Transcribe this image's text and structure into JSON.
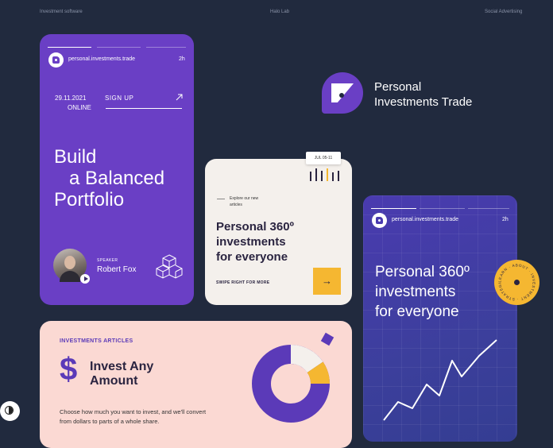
{
  "top_labels": {
    "left": "Investment software",
    "center": "Halo Lab",
    "right": "Social Advertising"
  },
  "story1": {
    "site": "personal.investments.trade",
    "time": "2h",
    "date": "29.11.2021",
    "mode": "ONLINE",
    "cta": "SIGN UP",
    "headline": [
      "Build",
      "a Balanced",
      "Portfolio"
    ],
    "speaker_role": "SPEAKER",
    "speaker_name": "Robert Fox"
  },
  "brand": {
    "line1": "Personal",
    "line2": "Investments Trade",
    "color": "#6a3fc5"
  },
  "post": {
    "date_tag": "JUL 05-11",
    "explore": [
      "Explore our new",
      "articles"
    ],
    "headline": [
      "Personal 360º",
      "investments",
      "for everyone"
    ],
    "swipe": "SWIPE RIGHT FOR MORE",
    "arrow": "→",
    "accent": "#f5b731"
  },
  "story2": {
    "site": "personal.investments.trade",
    "time": "2h",
    "headline": [
      "Personal 360º",
      "investments",
      "for everyone"
    ],
    "badge_text": "LEARN · ABOUT · INVESTMENT · STRATEGIES ·"
  },
  "article": {
    "tag": "INVESTMENTS ARTICLES",
    "symbol": "$",
    "title": [
      "Invest Any",
      "Amount"
    ],
    "body": [
      "Choose how much you want to invest, and we'll convert",
      "from dollars to parts of a whole share."
    ]
  },
  "colors": {
    "background": "#212a3e",
    "purple": "#6a3fc5",
    "yellow": "#f5b731",
    "pink": "#fbd9d3",
    "cream": "#f4f0ec",
    "blue": "#3c3f9c"
  }
}
